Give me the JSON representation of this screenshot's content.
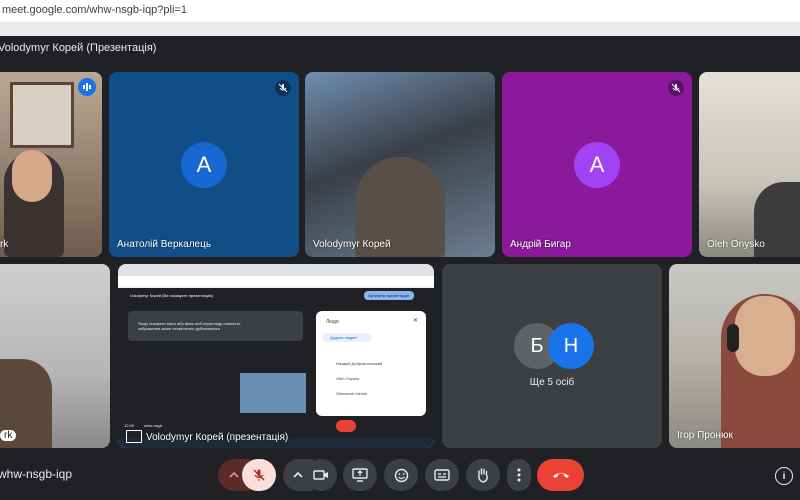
{
  "browser": {
    "url": "meet.google.com/whw-nsgb-iqp?pli=1"
  },
  "meeting": {
    "title": "Volodymyr Корей (Презентація)",
    "code": "whw-nsgb-iqp"
  },
  "tiles": [
    {
      "name": "rk",
      "type": "video"
    },
    {
      "name": "Анатолій Веркалець",
      "initial": "А",
      "avatar_color": "#1967d2",
      "bg": "#114e87"
    },
    {
      "name": "Volodymyr Корей",
      "type": "video"
    },
    {
      "name": "Андрій Бигар",
      "initial": "А",
      "avatar_color": "#a142f4",
      "bg": "#8a1a9b"
    },
    {
      "name": "Oleh Onysko",
      "type": "video"
    },
    {
      "name": "rk",
      "type": "video"
    },
    {
      "name": "Volodymyr Корей (презентація)",
      "type": "presentation"
    },
    {
      "name": "Ще 5 осіб",
      "initials": [
        "Б",
        "Н"
      ],
      "avatar_colors": [
        "#5f6368",
        "#1a73e8"
      ]
    },
    {
      "name": "Ігор Пронюк",
      "type": "video"
    }
  ],
  "presentation": {
    "inner_header": "Volodymyr Корей (Ви показуєте презентацію)",
    "inner_button": "Зупинити презентацію",
    "people_title": "Люди",
    "add_people": "Додати людей",
    "participants": [
      "Назарій Добровольський",
      "Oleh Onysko",
      "Oleksandr Melnik"
    ],
    "warn_text": "Якщо показати вікно або вікно веб-перегляду повністю, зображення може нескінченно дублюватися",
    "bottom_left": "whw-nsgb",
    "time": "12:09"
  },
  "controls": {
    "mic_state": "muted",
    "end_call_color": "#ea4335",
    "muted_color": "#f28b82"
  },
  "icons": [
    "raise-hand-icon",
    "mic-off-icon",
    "chevron-up-icon",
    "camera-icon",
    "present-icon",
    "emoji-icon",
    "captions-icon",
    "hand-icon",
    "more-vert-icon",
    "end-call-icon",
    "info-icon"
  ]
}
